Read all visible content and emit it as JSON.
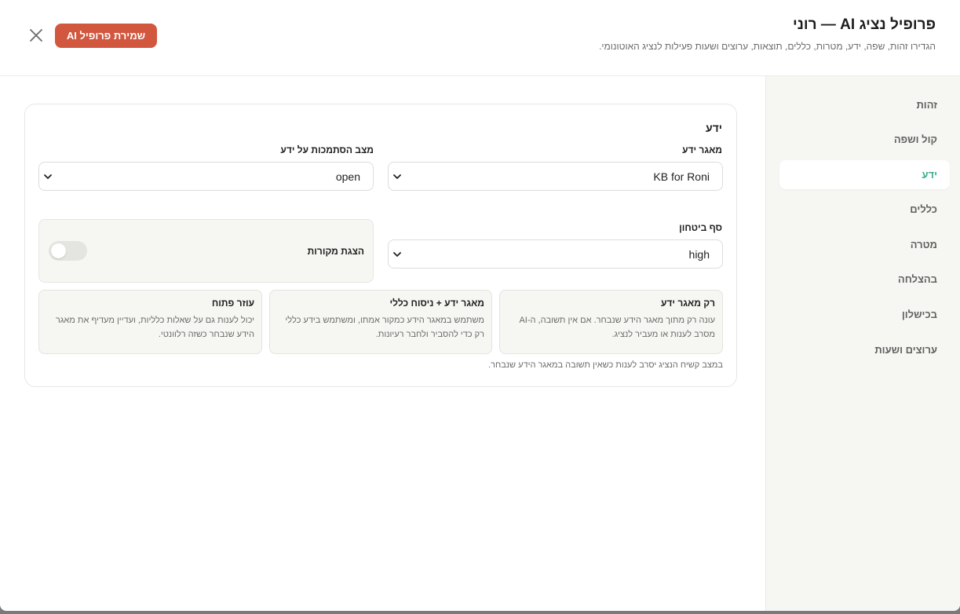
{
  "header": {
    "title": "פרופיל נציג AI — רוני",
    "subtitle": "הגדירו זהות, שפה, ידע, מטרות, כללים, תוצאות, ערוצים ושעות פעילות לנציג האוטונומי.",
    "save_label": "שמירת פרופיל AI",
    "close_icon": "close-icon"
  },
  "sidebar": {
    "items": [
      {
        "label": "זהות",
        "active": false
      },
      {
        "label": "קול ושפה",
        "active": false
      },
      {
        "label": "ידע",
        "active": true
      },
      {
        "label": "כללים",
        "active": false
      },
      {
        "label": "מטרה",
        "active": false
      },
      {
        "label": "בהצלחה",
        "active": false
      },
      {
        "label": "בכישלון",
        "active": false
      },
      {
        "label": "ערוצים ושעות",
        "active": false
      }
    ]
  },
  "knowledge": {
    "title": "ידע",
    "kb_label": "מאגר ידע",
    "kb_value": "KB for Roni",
    "mode_label": "מצב הסתמכות על ידע",
    "mode_value": "open",
    "confidence_label": "סף ביטחון",
    "confidence_value": "high",
    "sources_label": "הצגת מקורות",
    "sources_enabled": false,
    "options": [
      {
        "title": "רק מאגר ידע",
        "desc": "עונה רק מתוך מאגר הידע שנבחר. אם אין תשובה, ה-AI מסרב לענות או מעביר לנציג."
      },
      {
        "title": "מאגר ידע + ניסוח כללי",
        "desc": "משתמש במאגר הידע כמקור אמתו, ומשתמש בידע כללי רק כדי להסביר ולחבר רעיונות."
      },
      {
        "title": "עוזר פתוח",
        "desc": "יכול לענות גם על שאלות כלליות, ועדיין מעדיף את מאגר הידע שנבחר כשזה רלוונטי."
      }
    ],
    "hint": "במצב קשיח הנציג יסרב לענות כשאין תשובה במאגר הידע שנבחר."
  },
  "colors": {
    "accent": "#d2573f",
    "active_nav": "#3cae8c",
    "sidebar_bg": "#f6f6f3"
  }
}
